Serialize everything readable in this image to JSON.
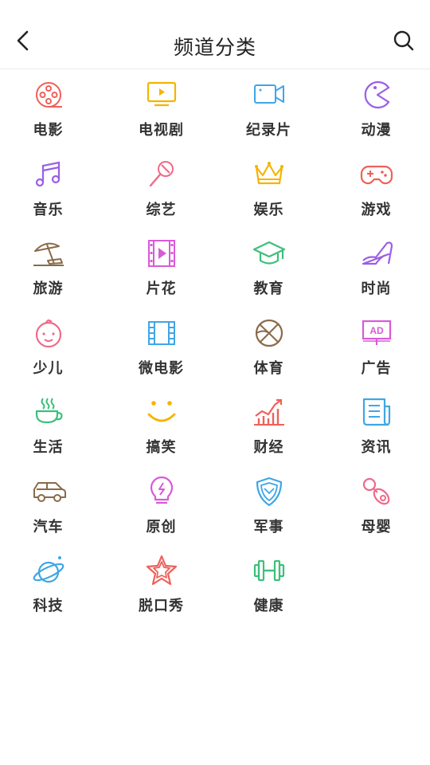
{
  "header": {
    "title": "频道分类"
  },
  "categories": [
    {
      "label": "电影",
      "icon": "film-reel-icon",
      "color": "#f0605a"
    },
    {
      "label": "电视剧",
      "icon": "tv-icon",
      "color": "#f5b400"
    },
    {
      "label": "纪录片",
      "icon": "video-camera-icon",
      "color": "#3fa6e6"
    },
    {
      "label": "动漫",
      "icon": "pacman-icon",
      "color": "#9b5ee6"
    },
    {
      "label": "音乐",
      "icon": "music-note-icon",
      "color": "#9b5ee6"
    },
    {
      "label": "综艺",
      "icon": "microphone-icon",
      "color": "#f06a8a"
    },
    {
      "label": "娱乐",
      "icon": "crown-icon",
      "color": "#f5b400"
    },
    {
      "label": "游戏",
      "icon": "gamepad-icon",
      "color": "#f0605a"
    },
    {
      "label": "旅游",
      "icon": "beach-umbrella-icon",
      "color": "#8a6a4a"
    },
    {
      "label": "片花",
      "icon": "film-strip-play-icon",
      "color": "#d95ad9"
    },
    {
      "label": "教育",
      "icon": "graduation-cap-icon",
      "color": "#3cc07a"
    },
    {
      "label": "时尚",
      "icon": "high-heel-icon",
      "color": "#9b5ee6"
    },
    {
      "label": "少儿",
      "icon": "baby-face-icon",
      "color": "#f06a8a"
    },
    {
      "label": "微电影",
      "icon": "film-frame-icon",
      "color": "#3fa6e6"
    },
    {
      "label": "体育",
      "icon": "basketball-icon",
      "color": "#8a6a4a"
    },
    {
      "label": "广告",
      "icon": "ad-board-icon",
      "color": "#d95ad9"
    },
    {
      "label": "生活",
      "icon": "coffee-cup-icon",
      "color": "#3cc07a"
    },
    {
      "label": "搞笑",
      "icon": "smile-icon",
      "color": "#f5b400"
    },
    {
      "label": "财经",
      "icon": "finance-chart-icon",
      "color": "#f0605a"
    },
    {
      "label": "资讯",
      "icon": "newspaper-icon",
      "color": "#3fa6e6"
    },
    {
      "label": "汽车",
      "icon": "car-icon",
      "color": "#8a6a4a"
    },
    {
      "label": "原创",
      "icon": "lightbulb-icon",
      "color": "#d95ad9"
    },
    {
      "label": "军事",
      "icon": "shield-icon",
      "color": "#3fa6e6"
    },
    {
      "label": "母婴",
      "icon": "pacifier-icon",
      "color": "#f06a8a"
    },
    {
      "label": "科技",
      "icon": "planet-icon",
      "color": "#3fa6e6"
    },
    {
      "label": "脱口秀",
      "icon": "star-icon",
      "color": "#f0605a"
    },
    {
      "label": "健康",
      "icon": "dumbbell-icon",
      "color": "#3cc07a"
    }
  ]
}
